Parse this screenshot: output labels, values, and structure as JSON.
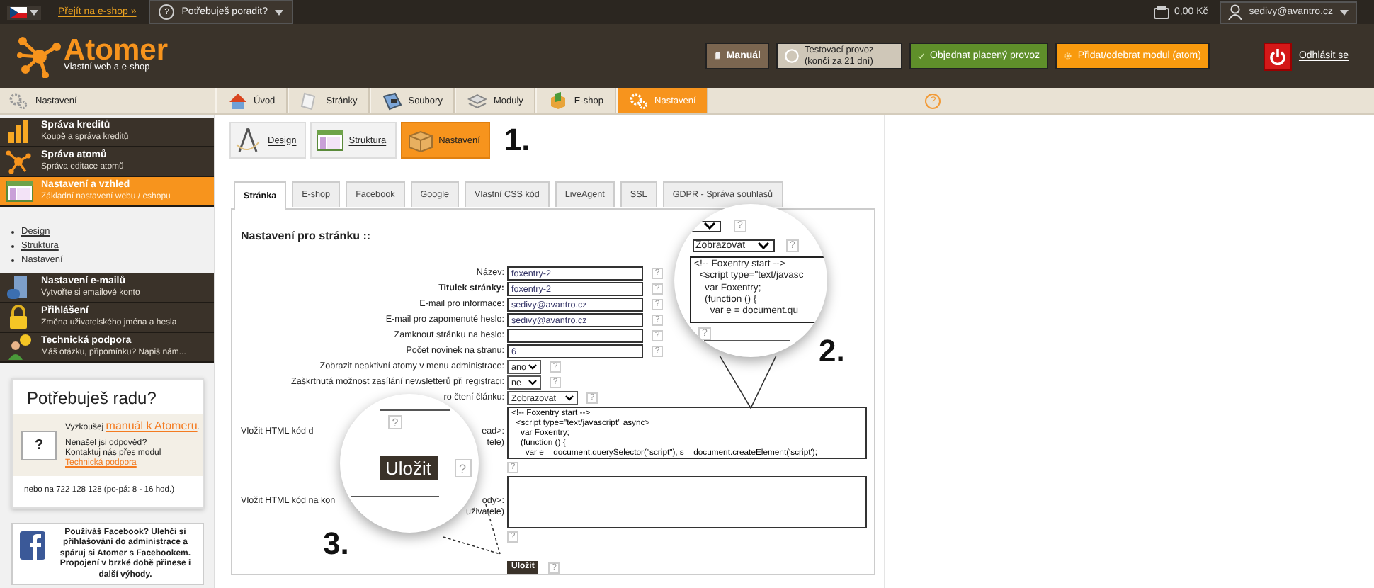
{
  "top_bar": {
    "eshop_link": "Přejít na e-shop »",
    "help_menu": {
      "icon_text": "?",
      "label": "Potřebuješ poradit?"
    },
    "credit": "0,00 Kč",
    "user": "sedivy@avantro.cz"
  },
  "header": {
    "logo": {
      "name": "Atomer",
      "tagline": "Vlastní web a e-shop"
    },
    "buttons": [
      {
        "kind": "manual",
        "lines": [
          "Manuál"
        ]
      },
      {
        "kind": "trial",
        "lines": [
          "Testovací provoz",
          "(končí za 21 dní)"
        ]
      },
      {
        "kind": "order",
        "lines": [
          "Objednat placený provoz"
        ]
      },
      {
        "kind": "module",
        "lines": [
          "Přidat/odebrat modul (atom)"
        ]
      }
    ],
    "logout": "Odhlásit se"
  },
  "nav": {
    "section": "Nastavení",
    "help": "?",
    "tabs": [
      {
        "kind": "home",
        "label": "Úvod",
        "selected": false
      },
      {
        "kind": "pages",
        "label": "Stránky",
        "selected": false
      },
      {
        "kind": "files",
        "label": "Soubory",
        "selected": false
      },
      {
        "kind": "modules",
        "label": "Moduly",
        "selected": false
      },
      {
        "kind": "eshop",
        "label": "E-shop",
        "selected": false
      },
      {
        "kind": "settings",
        "label": "Nastavení",
        "selected": true
      }
    ]
  },
  "sidebar": {
    "items": [
      {
        "kind": "credits",
        "title": "Správa kreditů",
        "subtitle": "Koupě a správa kreditů",
        "selected": false
      },
      {
        "kind": "atoms",
        "title": "Správa atomů",
        "subtitle": "Správa editace atomů",
        "selected": false
      },
      {
        "kind": "look",
        "title": "Nastavení a vzhled",
        "subtitle": "Základní nastavení webu / eshopu",
        "selected": true,
        "children": [
          {
            "label": "Design",
            "selected": false
          },
          {
            "label": "Struktura",
            "selected": false
          },
          {
            "label": "Nastavení",
            "selected": true
          }
        ]
      },
      {
        "kind": "email",
        "title": "Nastavení e-mailů",
        "subtitle": "Vytvořte si emailové konto",
        "selected": false
      },
      {
        "kind": "login",
        "title": "Přihlášení",
        "subtitle": "Změna uživatelského jména a hesla",
        "selected": false
      },
      {
        "kind": "support",
        "title": "Technická podpora",
        "subtitle": "Máš otázku, připomínku? Napiš nám...",
        "selected": false
      }
    ]
  },
  "help_box": {
    "title": "Potřebuješ radu?",
    "icon_text": "?",
    "intro": {
      "before": "Vyzkoušej ",
      "link": "manuál k Atomeru",
      "after": "."
    },
    "contact": {
      "lines": [
        "Nenašel jsi odpověď?",
        "Kontaktuj nás přes modul"
      ],
      "link": "Technická podpora"
    },
    "phone": "nebo na 722 128 128 (po-pá: 8 - 16 hod.)"
  },
  "facebook_box": {
    "text": "Používáš Facebook? Ulehči si přihlašování do administrace a spáruj si Atomer s Facebookem. Propojení v brzké době přinese i další výhody."
  },
  "main": {
    "subtabs": [
      {
        "kind": "design",
        "label": "Design",
        "selected": false
      },
      {
        "kind": "structure",
        "label": "Struktura",
        "selected": false
      },
      {
        "kind": "settings",
        "label": "Nastavení",
        "selected": true
      }
    ],
    "step": "1.",
    "tabs": [
      {
        "label": "Stránka",
        "selected": true
      },
      {
        "label": "E-shop",
        "selected": false
      },
      {
        "label": "Facebook",
        "selected": false
      },
      {
        "label": "Google",
        "selected": false
      },
      {
        "label": "Vlastní CSS kód",
        "selected": false
      },
      {
        "label": "LiveAgent",
        "selected": false
      },
      {
        "label": "SSL",
        "selected": false
      },
      {
        "label": "GDPR - Správa souhlasů",
        "selected": false
      }
    ],
    "form": {
      "heading": "Nastavení pro stránku ::",
      "fields": [
        {
          "kind": "text",
          "label": "Název:",
          "emphasized": false,
          "value": "foxentry-2",
          "help": "?"
        },
        {
          "kind": "text",
          "label": "Titulek stránky:",
          "emphasized": true,
          "value": "foxentry-2",
          "help": "?"
        },
        {
          "kind": "text",
          "label": "E-mail pro informace:",
          "emphasized": false,
          "value": "sedivy@avantro.cz",
          "help": "?"
        },
        {
          "kind": "text",
          "label": "E-mail pro zapomenuté heslo:",
          "emphasized": false,
          "value": "sedivy@avantro.cz",
          "help": "?"
        },
        {
          "kind": "text",
          "label": "Zamknout stránku na heslo:",
          "emphasized": false,
          "help": "?"
        },
        {
          "kind": "text",
          "label": "Počet novinek na stranu:",
          "emphasized": false,
          "value": "6",
          "help": "?"
        },
        {
          "kind": "select",
          "label": "Zobrazit neaktivní atomy v menu administrace:",
          "emphasized": false,
          "value": "ano",
          "help": "?"
        },
        {
          "kind": "select",
          "label": "Zaškrtnutá možnost zasílání newsletterů při registraci:",
          "emphasized": false,
          "value": "ne",
          "help": "?"
        },
        {
          "kind": "select",
          "label": "ro čtení článku:",
          "emphasized": false,
          "value": "Zobrazovat",
          "help": "?"
        },
        {
          "kind": "code",
          "label_start": "Vložit HTML kód d",
          "label_end": [
            "ead>:",
            "tele)"
          ],
          "emphasized": false,
          "value": "<!-- Foxentry start -->\n  <script type=\"text/javascript\" async>\n    var Foxentry;\n    (function () {\n      var e = document.querySelector(\"script\"), s = document.createElement('script');",
          "help": "?"
        },
        {
          "kind": "code",
          "label_start": "Vložit HTML kód na kon",
          "label_end": [
            "ody>:",
            "uživatele)"
          ],
          "emphasized": false,
          "help": "?"
        }
      ],
      "save": "Uložit",
      "save_help": "?"
    }
  },
  "magnifiers": [
    {
      "kind": "code",
      "step": "2.",
      "helps": [
        "?",
        "?",
        "?"
      ],
      "select_value": "Zobrazovat",
      "code_lines": [
        "<!-- Foxentry start -->",
        "  <script type=\"text/javasc",
        "    var Foxentry;",
        "    (function () {",
        "      var e = document.qu"
      ]
    },
    {
      "kind": "save",
      "step": "3.",
      "helps": [
        "?",
        "?"
      ],
      "button": "Uložit"
    }
  ]
}
